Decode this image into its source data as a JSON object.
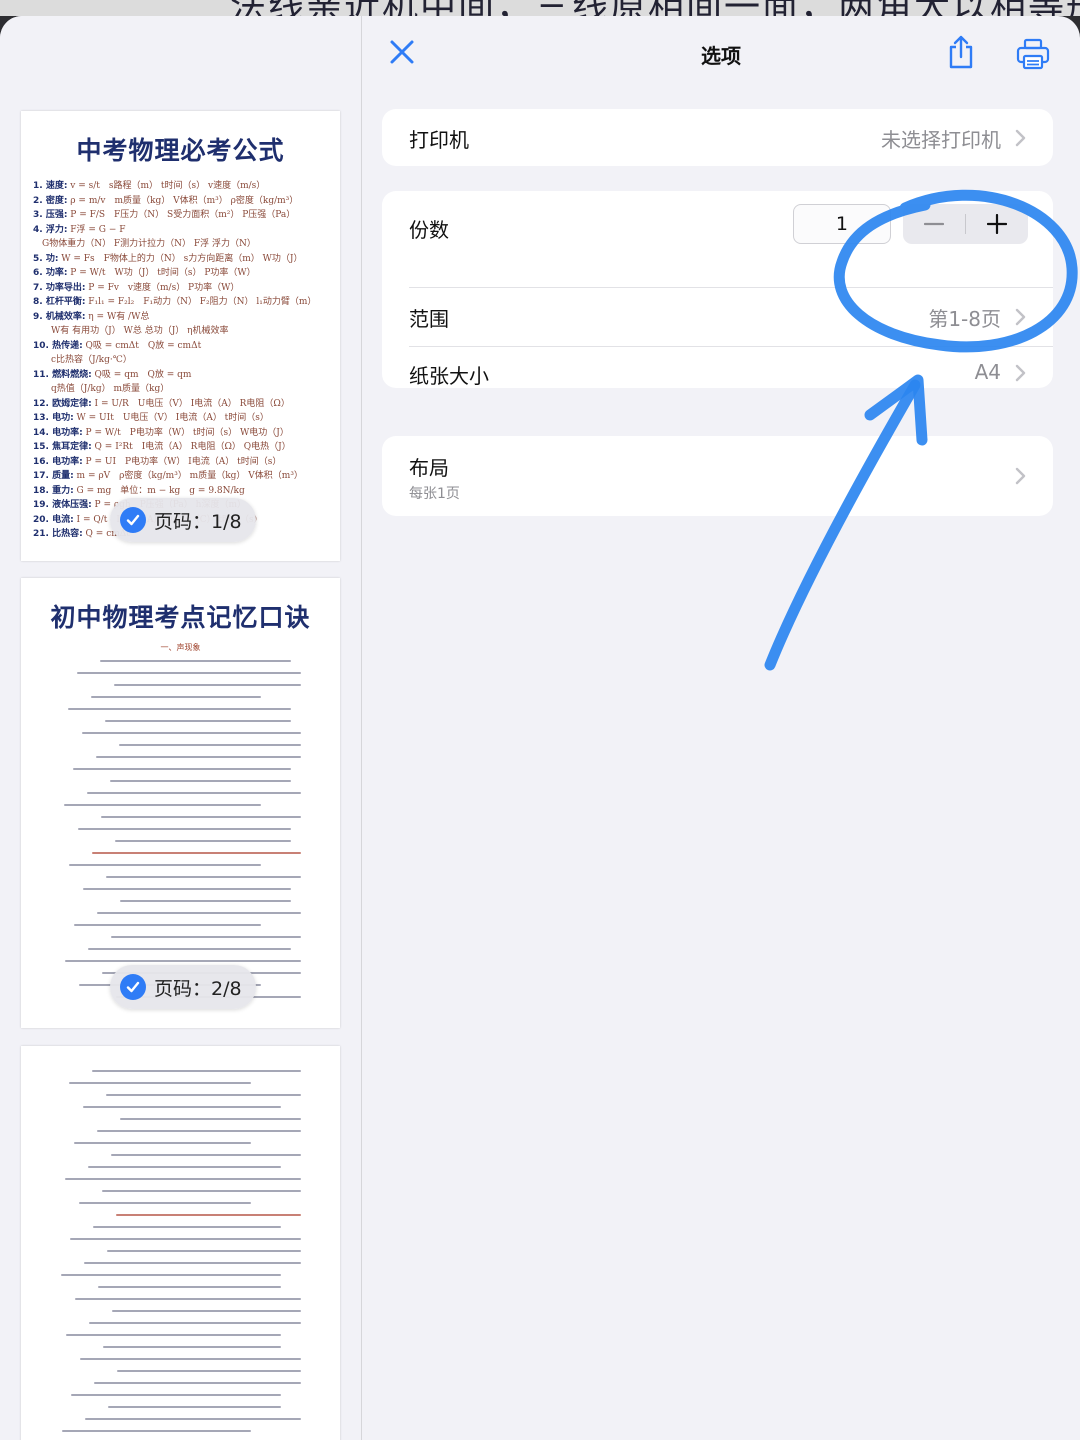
{
  "background": {
    "snippet": "法线亲近机中间，三线原相间一面，两角大以相等形，"
  },
  "sidebar": {
    "thumbnails": [
      {
        "title": "中考物理必考公式",
        "badge": "页码：1/8",
        "lines": [
          {
            "k": "1. 速度:",
            "v": "v = s/t　s路程（m） t时间（s） v速度（m/s）"
          },
          {
            "k": "2. 密度:",
            "v": "ρ = m/v　m质量（kg） V体积（m³） ρ密度（kg/m³）"
          },
          {
            "k": "3. 压强:",
            "v": "P = F/S　F压力（N） S受力面积（m²） P压强（Pa）"
          },
          {
            "k": "4. 浮力:",
            "v": "F浮 = G − F"
          },
          {
            "k": "",
            "v": "　G物体重力（N） F测力计拉力（N） F浮 浮力（N）"
          },
          {
            "k": "5. 功:",
            "v": "W = Fs　F物体上的力（N） s力方向距离（m） W功（J）"
          },
          {
            "k": "6. 功率:",
            "v": "P = W/t　W功（J） t时间（s） P功率（W）"
          },
          {
            "k": "7. 功率导出:",
            "v": "P = Fv　v速度（m/s） P功率（W）"
          },
          {
            "k": "8. 杠杆平衡:",
            "v": "F₁l₁ = F₂l₂　F₁动力（N） F₂阻力（N） l₁动力臂（m）"
          },
          {
            "k": "9. 机械效率:",
            "v": "η = W有 /W总"
          },
          {
            "k": "",
            "v": "　　W有 有用功（J） W总 总功（J） η机械效率"
          },
          {
            "k": "10. 热传递:",
            "v": "Q吸 = cmΔt　Q放 = cmΔt"
          },
          {
            "k": "",
            "v": "　　c比热容（J/kg·℃）"
          },
          {
            "k": "11. 燃料燃烧:",
            "v": "Q吸 = qm　Q放 = qm"
          },
          {
            "k": "",
            "v": "　　q热值（J/kg） m质量（kg）"
          },
          {
            "k": "12. 欧姆定律:",
            "v": "I = U/R　U电压（V） I电流（A） R电阻（Ω）"
          },
          {
            "k": "13. 电功:",
            "v": "W = UIt　U电压（V） I电流（A） t时间（s）"
          },
          {
            "k": "14. 电功率:",
            "v": "P = W/t　P电功率（W） t时间（s） W电功（J）"
          },
          {
            "k": "15. 焦耳定律:",
            "v": "Q = I²Rt　I电流（A） R电阻（Ω） Q电热（J）"
          },
          {
            "k": "16. 电功率:",
            "v": "P = UI　P电功率（W） I电流（A） t时间（s）"
          },
          {
            "k": "17. 质量:",
            "v": "m = ρV　ρ密度（kg/m³） m质量（kg） V体积（m³）"
          },
          {
            "k": "18. 重力:",
            "v": "G = mg　单位：m − kg　g = 9.8N/kg"
          },
          {
            "k": "19. 液体压强:",
            "v": "P = ρgh　P压强（Pa） h深度（m）"
          },
          {
            "k": "20. 电流:",
            "v": "I = Q/t　I电流（A） Q电荷（C） t时间（s）"
          },
          {
            "k": "21. 比热容:",
            "v": "Q = cmΔt"
          }
        ]
      },
      {
        "title": "初中物理考点记忆口诀",
        "subtitle": "一、声现象",
        "badge": "页码：2/8"
      },
      {
        "title": ""
      }
    ]
  },
  "header": {
    "title": "选项"
  },
  "printer": {
    "label": "打印机",
    "value": "未选择打印机"
  },
  "copies": {
    "label": "份数",
    "value": "1",
    "minus": "−",
    "plus": "+"
  },
  "range": {
    "label": "范围",
    "value": "第1-8页"
  },
  "paper": {
    "label": "纸张大小",
    "value": "A4"
  },
  "layout": {
    "label": "布局",
    "sub": "每张1页"
  },
  "colors": {
    "accent": "#2f7cf6",
    "annotation": "#2b86f0",
    "thumb_title": "#1f2f6e"
  }
}
